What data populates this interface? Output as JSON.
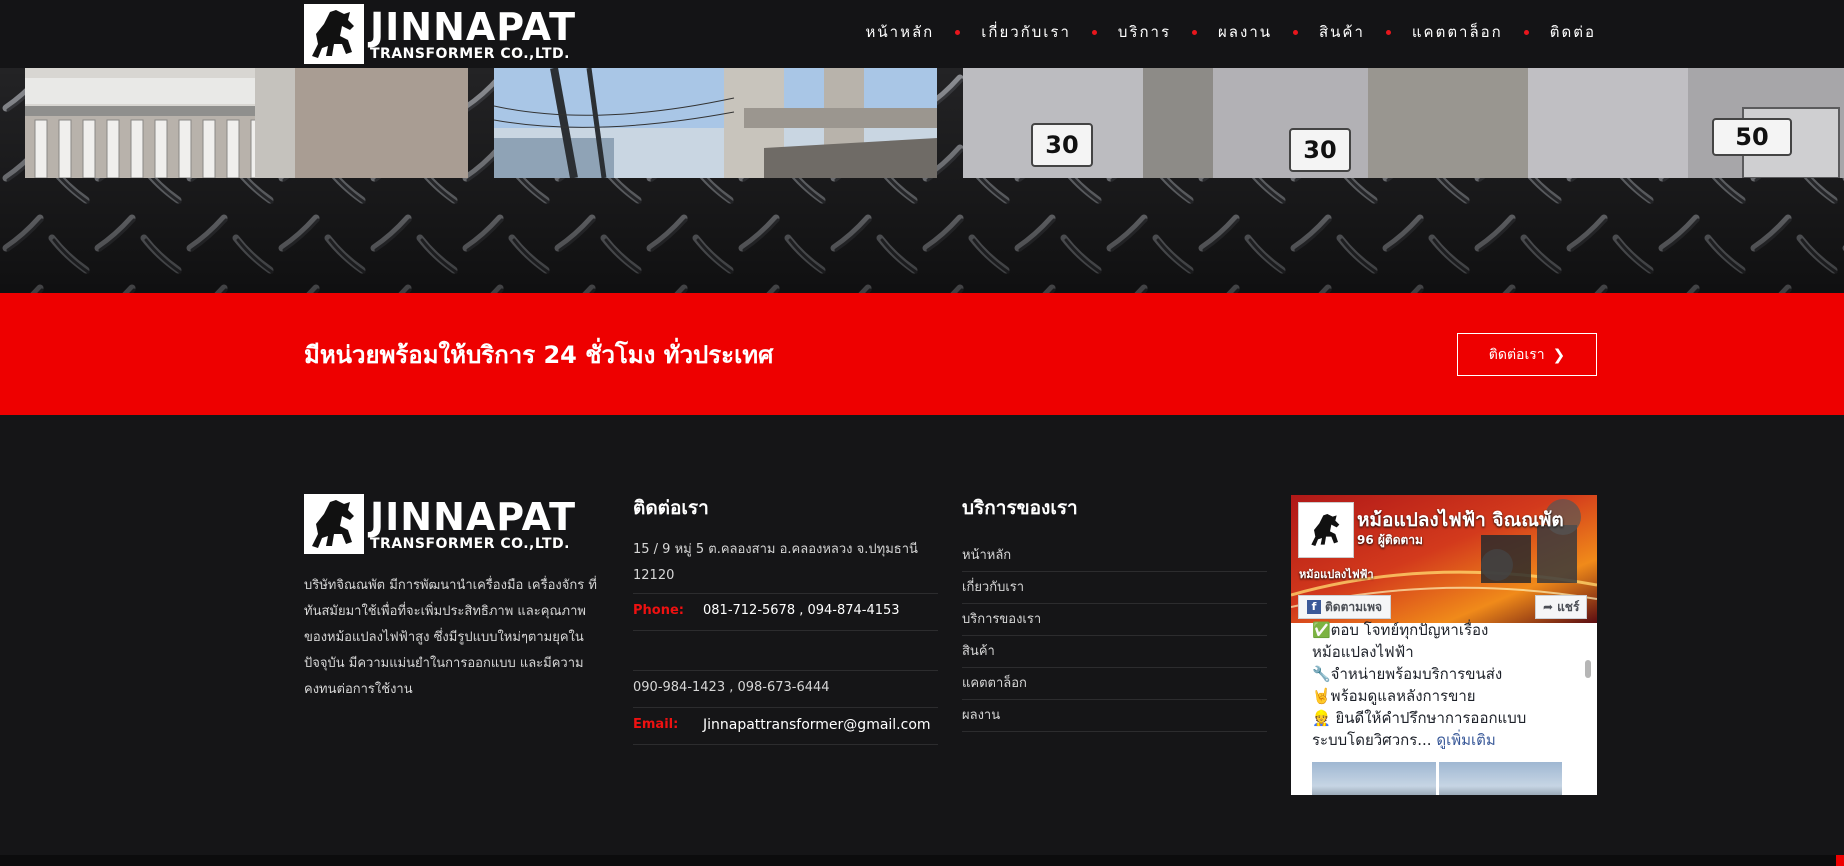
{
  "brand": {
    "name": "JINNAPAT",
    "subtitle": "TRANSFORMER CO.,LTD."
  },
  "nav": {
    "items": [
      {
        "label": "หน้าหลัก"
      },
      {
        "label": "เกี่ยวกับเรา"
      },
      {
        "label": "บริการ"
      },
      {
        "label": "ผลงาน"
      },
      {
        "label": "สินค้า"
      },
      {
        "label": "แคตตาล็อก"
      },
      {
        "label": "ติดต่อ"
      }
    ]
  },
  "hero": {
    "badges": [
      "30",
      "30",
      "50"
    ]
  },
  "cta": {
    "title": "มีหน่วยพร้อมให้บริการ 24 ชั่วโมง ทั่วประเทศ",
    "button_label": "ติดต่อเรา"
  },
  "footer": {
    "about": "บริษัทจิณณพัต มีการพัฒนานำเครื่องมือ เครื่องจักร ที่ทันสมัยมาใช้เพื่อที่จะเพิ่มประสิทธิภาพ และคุณภาพของหม้อแปลงไฟฟ้าสูง ซึ่งมีรูปแบบใหม่ๆตามยุคในปัจจุบัน มีความแม่นยำในการออกแบบ และมีความคงทนต่อการใช้งาน",
    "contact": {
      "title": "ติดต่อเรา",
      "address": "15 / 9 หมู่ 5 ต.คลองสาม อ.คลองหลวง จ.ปทุมธานี 12120",
      "phone_label": "Phone:",
      "phone": "081-712-5678 , 094-874-4153",
      "phone2": "090-984-1423 , 098-673-6444",
      "email_label": "Email:",
      "email": "Jinnapattransformer@gmail.com"
    },
    "services": {
      "title": "บริการของเรา",
      "items": [
        {
          "label": "หน้าหลัก"
        },
        {
          "label": "เกี่ยวกับเรา"
        },
        {
          "label": "บริการของเรา"
        },
        {
          "label": "สินค้า"
        },
        {
          "label": "แคตตาล็อก"
        },
        {
          "label": "ผลงาน"
        }
      ]
    },
    "facebook": {
      "page_name": "หม้อแปลงไฟฟ้า จิณณพัต",
      "followers": "96 ผู้ติดตาม",
      "cover_caption": "หม้อแปลงไฟฟ้า",
      "follow_label": "ติดตามเพจ",
      "share_label": "แชร์",
      "post_lines": [
        "✅ตอบ โจทย์ทุกปัญหาเรื่อง",
        "หม้อแปลงไฟฟ้า",
        "🔧จำหน่ายพร้อมบริการขนส่ง",
        "🤘พร้อมดูแลหลังการขาย",
        "👷 ยินดีให้คำปรึกษาการออกแบบ"
      ],
      "post_last_line": "ระบบโดยวิศวกร...",
      "see_more": "ดูเพิ่มเติม"
    }
  }
}
